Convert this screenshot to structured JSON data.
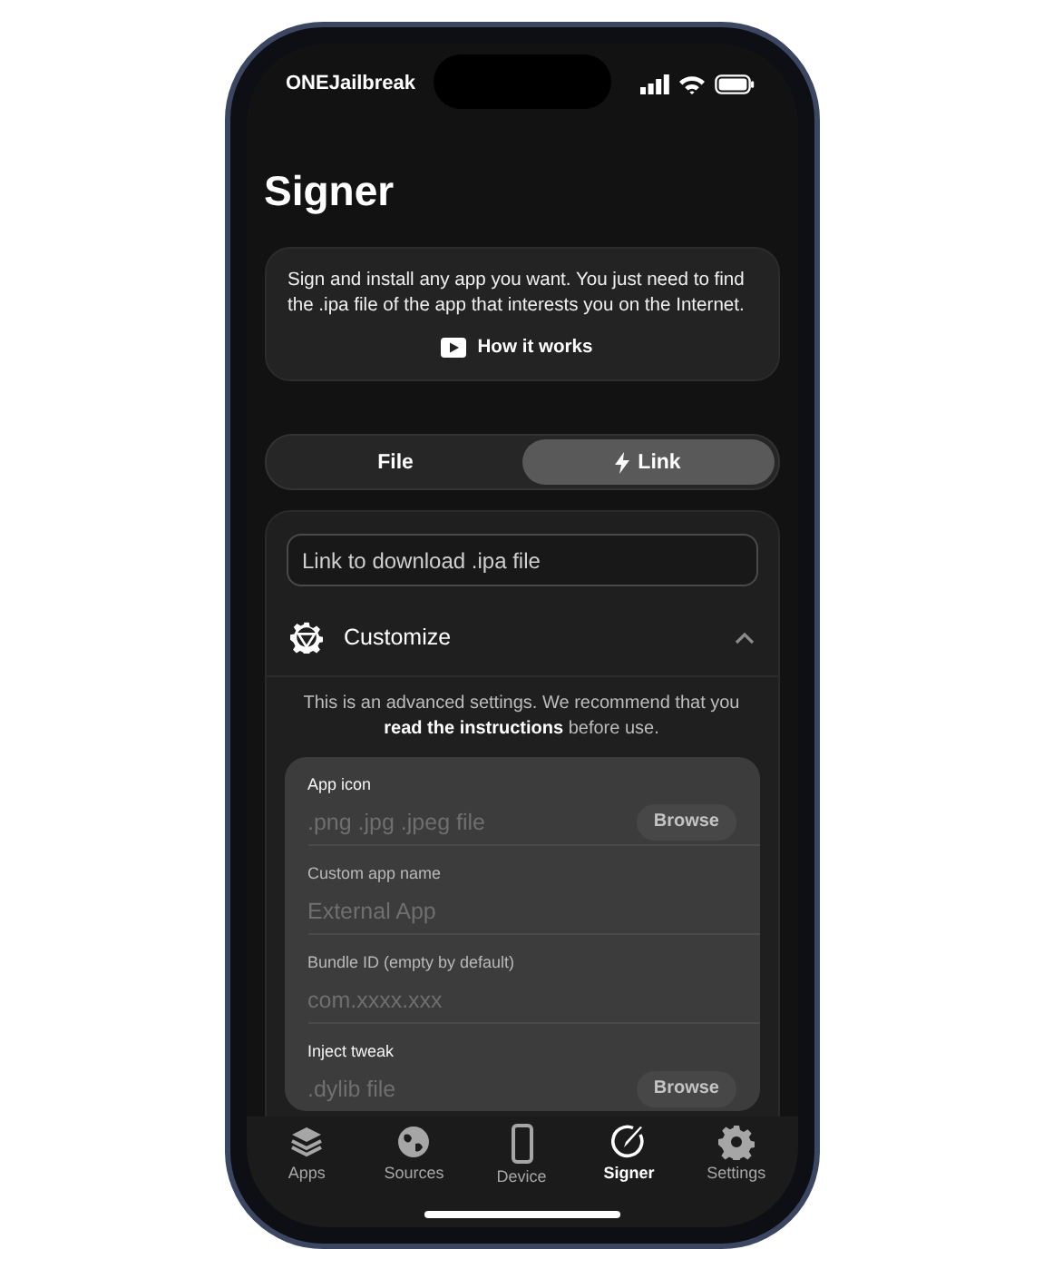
{
  "status_bar": {
    "carrier": "ONEJailbreak"
  },
  "title": "Signer",
  "info_card": {
    "text": "Sign and install any app you want. You just need to find the .ipa file of the app that interests you on the Internet.",
    "link": "How it works"
  },
  "segments": [
    {
      "kind": "plain",
      "label": "File",
      "selected": false
    },
    {
      "kind": "lightning",
      "label": "Link",
      "selected": true
    }
  ],
  "link_field": {
    "placeholder": "Link to download .ipa file"
  },
  "customize": {
    "title": "Customize",
    "expanded": true
  },
  "note": "This is an advanced settings. We recommend that you **read the instructions** before use.",
  "fields": [
    {
      "kind": "file",
      "label": "App icon",
      "placeholder": ".png .jpg .jpeg file",
      "button": "Browse"
    },
    {
      "kind": "text",
      "label": "Custom app name",
      "placeholder": "External App"
    },
    {
      "kind": "text",
      "label": "Bundle ID (empty by default)",
      "placeholder": "com.xxxx.xxx"
    },
    {
      "kind": "file",
      "label": "Inject tweak",
      "placeholder": ".dylib file",
      "button": "Browse"
    }
  ],
  "tabs": [
    {
      "label": "Apps",
      "selected": false
    },
    {
      "label": "Sources",
      "selected": false
    },
    {
      "label": "Device",
      "selected": false
    },
    {
      "label": "Signer",
      "selected": true
    },
    {
      "label": "Settings",
      "selected": false
    }
  ]
}
